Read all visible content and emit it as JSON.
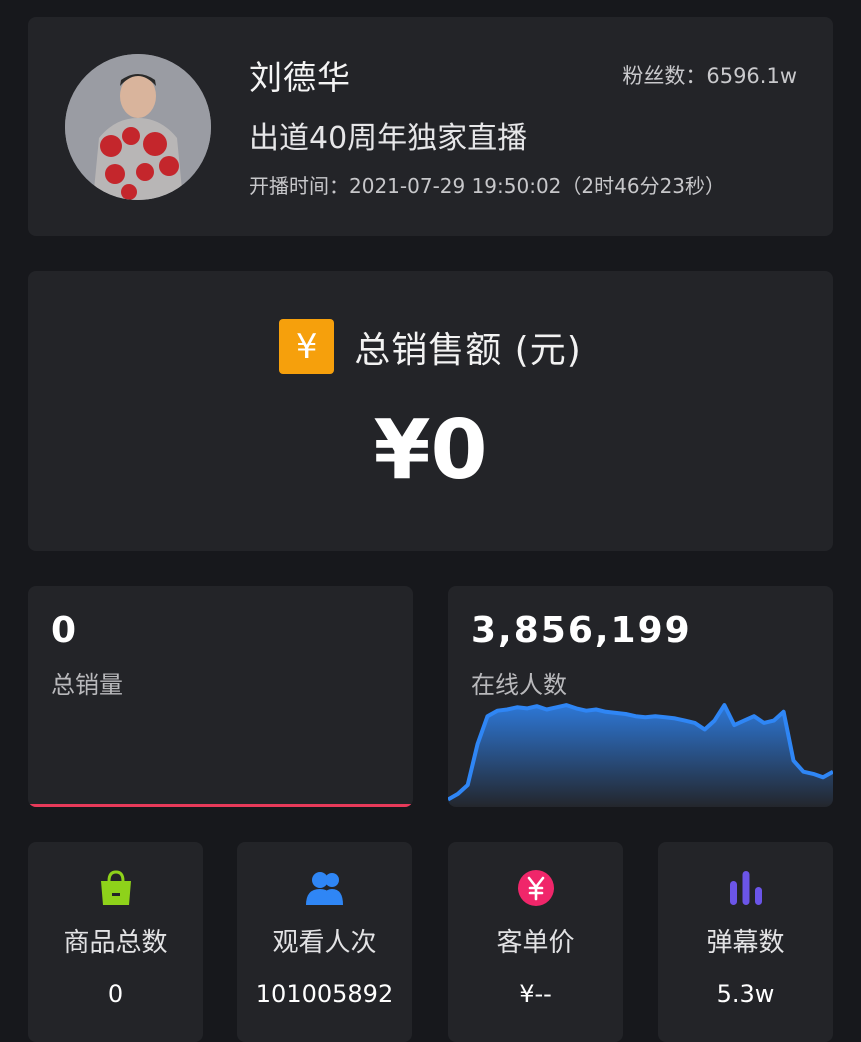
{
  "host": {
    "name": "刘德华",
    "fans": "粉丝数：6596.1w",
    "title": "出道40周年独家直播",
    "start_time": "开播时间：2021-07-29 19:50:02（2时46分23秒）"
  },
  "sales": {
    "icon": "yen-badge-icon",
    "icon_glyph": "¥",
    "label": "总销售额 (元)",
    "value": "¥0",
    "badge_color": "#f6a00c"
  },
  "stats": {
    "quantity": {
      "value": "0",
      "label": "总销量",
      "accent": "#e83a5a"
    },
    "online": {
      "value": "3,856,199",
      "label": "在线人数",
      "accent": "#2f86f5"
    }
  },
  "chart_data": {
    "type": "area",
    "title": "",
    "xlabel": "",
    "ylabel": "",
    "series": [
      {
        "values": [
          0.05,
          0.1,
          0.18,
          0.55,
          0.8,
          0.85,
          0.86,
          0.88,
          0.87,
          0.89,
          0.86,
          0.88,
          0.9,
          0.87,
          0.85,
          0.86,
          0.84,
          0.83,
          0.82,
          0.8,
          0.79,
          0.8,
          0.79,
          0.78,
          0.76,
          0.74,
          0.68,
          0.76,
          0.9,
          0.72,
          0.76,
          0.8,
          0.74,
          0.76,
          0.84,
          0.4,
          0.3,
          0.28,
          0.25,
          0.3
        ]
      }
    ],
    "ylim": [
      0,
      1
    ],
    "grid": false
  },
  "metrics": [
    {
      "label": "商品总数",
      "value": "0",
      "icon": "shopping-bag-icon",
      "color": "#8ed21a"
    },
    {
      "label": "观看人次",
      "value": "101005892",
      "icon": "users-icon",
      "color": "#2f86f5"
    },
    {
      "label": "客单价",
      "value": "¥--",
      "icon": "yen-circle-icon",
      "color": "#f0266a"
    },
    {
      "label": "弹幕数",
      "value": "5.3w",
      "icon": "bar-chart-icon",
      "color": "#6b55e8"
    }
  ]
}
